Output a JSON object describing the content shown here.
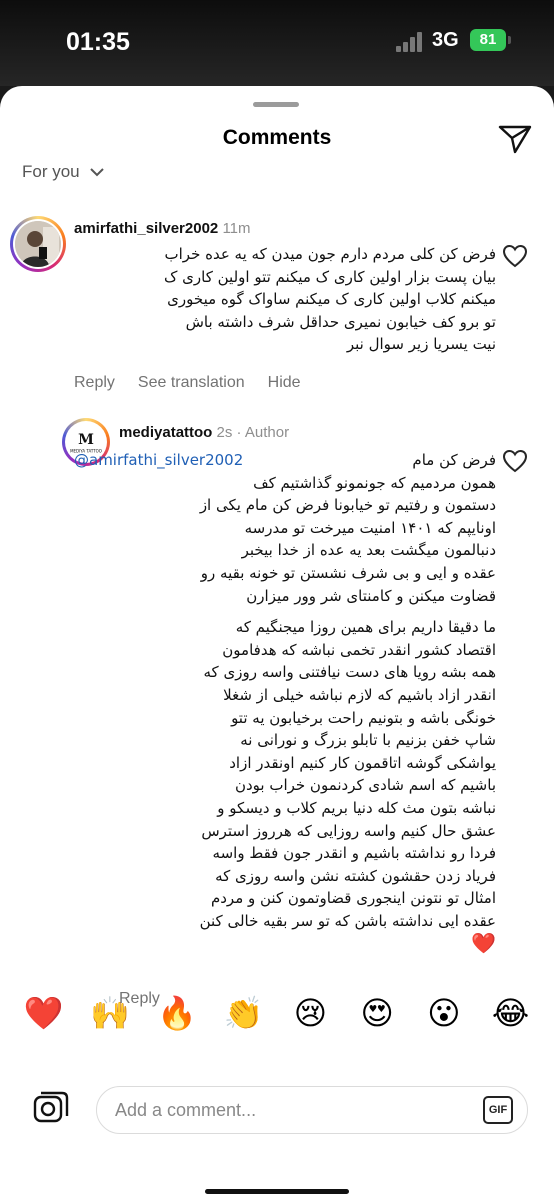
{
  "status_bar": {
    "time": "01:35",
    "network": "3G",
    "battery": "81"
  },
  "sheet": {
    "title": "Comments",
    "filter_label": "For you"
  },
  "comments": [
    {
      "username": "amirfathi_silver2002",
      "timestamp": "11m",
      "lines": [
        "فرض کن کلی مردم دارم جون میدن که یه عده خراب",
        "بیان پست بزار اولین کاری ک میکنم تتو اولین کاری ک",
        "میکنم کلاب اولین کاری ک میکنم ساواک گوه میخوری",
        "تو برو کف خیابون  نمیری حداقل شرف داشته باش",
        "نیت یسریا زیر سوال نبر"
      ],
      "actions": [
        "Reply",
        "See translation",
        "Hide"
      ]
    },
    {
      "username": "mediyatattoo",
      "timestamp": "2s",
      "badge": "Author",
      "mention": "@amirfathi_silver2002",
      "first_line_rest": "فرض  کن  مام",
      "lines": [
        "همون مردمیم که   جونمونو گذاشتیم کف",
        "دستمون و رفتیم تو خیابونا فرض کن مام یکی از",
        "اونایپم که ۱۴۰۱ امنیت میرخت تو مدرسه",
        "دنبالمون میگشت  بعد یه عده از خدا بیخبر",
        "عقده و ایی و بی شرف نشستن تو خونه بقیه رو",
        "قضاوت میکنن و کامنتای شر وور میزارن",
        "ما دقیقا داریم برای همین روزا میجنگیم که",
        "اقتصاد کشور انقدر تخمی نباشه که هدفامون",
        "همه بشه رویا های دست نیافتنی واسه روزی که",
        "انقدر ازاد باشیم که لازم نباشه خیلی از شغلا",
        "خونگی باشه و بتونیم راحت برخیابون یه تتو",
        "شاپ خفن بزنیم با تابلو بزرگ و نورانی نه",
        "یواشکی گوشه اتاقمون کار کنیم  اونقدر ازاد",
        "باشیم که اسم شادی کردنمون خراب بودن",
        "نباشه بتون مث کله دنیا بریم کلاب و دیسکو  و",
        "عشق حال کنیم واسه روزایی که هرروز استرس",
        "فردا رو نداشته باشیم و انقدر جون فقط واسه",
        "فریاد زدن حقشون کشته نشن واسه روزی که",
        "امثال تو نتونن اینجوری قضاوتمون کنن و مردم",
        "عقده ایی نداشته باشن که تو سر بقیه خالی کنن"
      ],
      "end_emoji": "❤️",
      "avatar_text": "MEDIYA TATTOO",
      "actions": [
        "Reply"
      ]
    }
  ],
  "emoji_bar": [
    "❤️",
    "🙌",
    "🔥",
    "👏",
    "😢",
    "😍",
    "😮",
    "😂"
  ],
  "composer": {
    "placeholder": "Add a comment...",
    "gif_label": "GIF"
  }
}
